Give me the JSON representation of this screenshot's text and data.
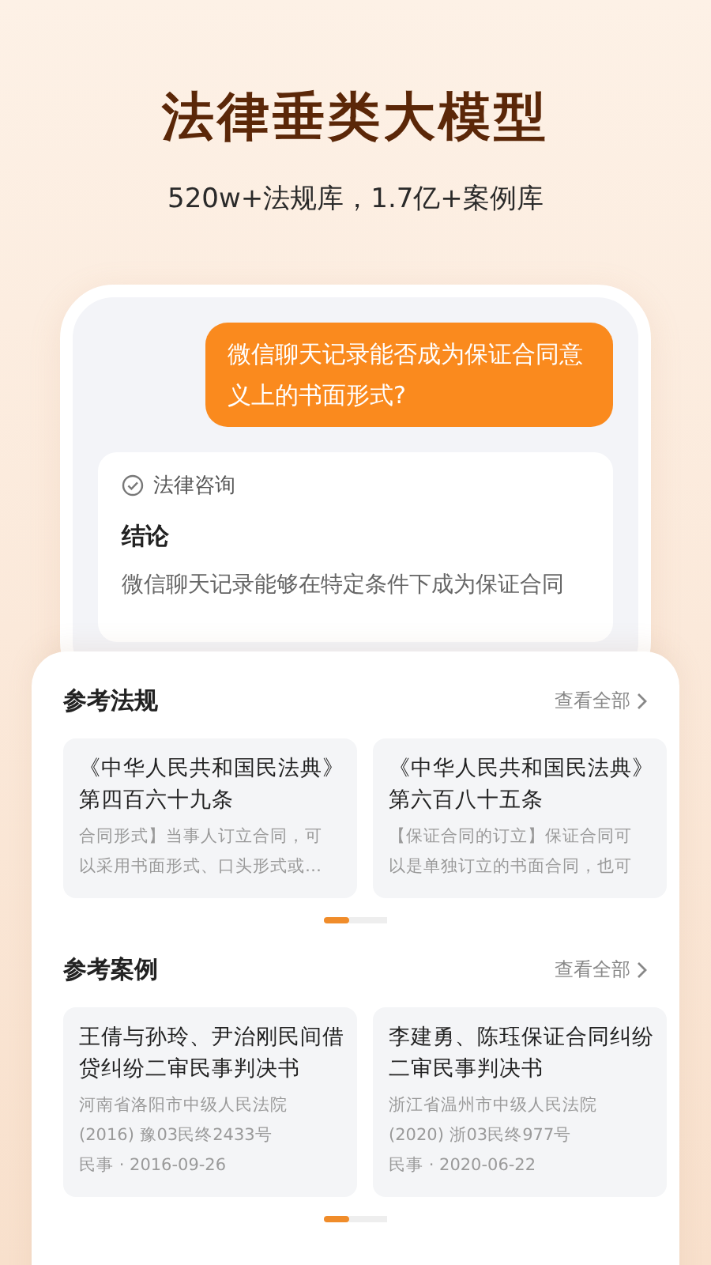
{
  "headline": "法律垂类大模型",
  "subtitle": "520w+法规库，1.7亿+案例库",
  "chat": {
    "question": "微信聊天记录能否成为保证合同意义上的书面形式?",
    "answer_tag": "法律咨询",
    "answer_heading": "结论",
    "answer_text": "微信聊天记录能够在特定条件下成为保证合同"
  },
  "sections": [
    {
      "title": "参考法规",
      "view_all": "查看全部",
      "cards": [
        {
          "title_lines": [
            "《中华人民共和国民法典》",
            "第四百六十九条"
          ],
          "detail_lines": [
            "合同形式】当事人订立合同，可",
            "以采用书面形式、口头形式或…"
          ]
        },
        {
          "title_lines": [
            "《中华人民共和国民法典》",
            "第六百八十五条"
          ],
          "detail_lines": [
            "【保证合同的订立】保证合同可",
            "以是单独订立的书面合同，也可"
          ]
        }
      ],
      "pager": [
        {
          "selected": true
        },
        {
          "selected": false
        }
      ]
    },
    {
      "title": "参考案例",
      "view_all": "查看全部",
      "cards": [
        {
          "title_lines": [
            "王倩与孙玲、尹治刚民间借",
            "贷纠纷二审民事判决书"
          ],
          "detail_lines": [
            "河南省洛阳市中级人民法院",
            "(2016) 豫03民终2433号",
            "民事 · 2016-09-26"
          ]
        },
        {
          "title_lines": [
            "李建勇、陈珏保证合同纠纷",
            "二审民事判决书"
          ],
          "detail_lines": [
            "浙江省温州市中级人民法院",
            "(2020) 浙03民终977号",
            "民事 · 2020-06-22"
          ]
        }
      ],
      "pager": [
        {
          "selected": true
        },
        {
          "selected": false
        }
      ]
    }
  ]
}
